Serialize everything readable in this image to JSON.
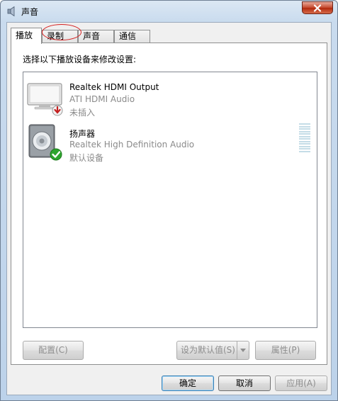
{
  "window": {
    "title": "声音",
    "icon": "speaker-icon",
    "close_icon": "close-icon"
  },
  "tabs": [
    {
      "label": "播放",
      "active": true
    },
    {
      "label": "录制",
      "active": false
    },
    {
      "label": "声音",
      "active": false
    },
    {
      "label": "通信",
      "active": false
    }
  ],
  "playback": {
    "instruction": "选择以下播放设备来修改设置:",
    "devices": [
      {
        "name": "Realtek HDMI Output",
        "driver": "ATI HDMI Audio",
        "status": "未插入",
        "icon": "hdmi-monitor-icon",
        "badge": "unplugged-arrow-icon"
      },
      {
        "name": "扬声器",
        "driver": "Realtek High Definition Audio",
        "status": "默认设备",
        "icon": "speaker-device-icon",
        "badge": "default-checkmark-icon",
        "level": 0
      }
    ]
  },
  "buttons": {
    "configure": "配置(C)",
    "set_default": "设为默认值(S)",
    "properties": "属性(P)",
    "ok": "确定",
    "cancel": "取消",
    "apply": "应用(A)"
  },
  "colors": {
    "hint_circle": "#d42020",
    "checkmark": "#2ea52e",
    "unplugged": "#c42020"
  }
}
